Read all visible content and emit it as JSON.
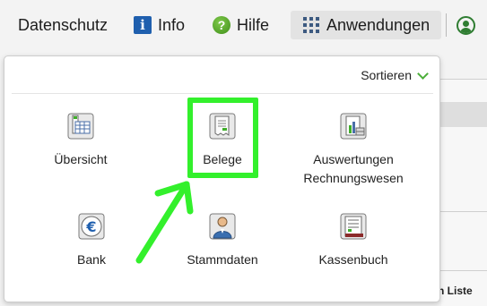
{
  "topbar": {
    "datenschutz": "Datenschutz",
    "info": "Info",
    "hilfe": "Hilfe",
    "anwendungen": "Anwendungen"
  },
  "menu": {
    "sort_label": "Sortieren",
    "items": [
      {
        "label": "Übersicht",
        "icon": "overview-icon"
      },
      {
        "label": "Belege",
        "icon": "receipts-icon"
      },
      {
        "label": "Auswertungen Rechnungswesen",
        "icon": "reports-icon"
      },
      {
        "label": "Bank",
        "icon": "bank-icon"
      },
      {
        "label": "Stammdaten",
        "icon": "master-data-icon"
      },
      {
        "label": "Kassenbuch",
        "icon": "cash-book-icon"
      }
    ]
  },
  "background": {
    "liste_text": "n Liste"
  },
  "colors": {
    "highlight": "#33f02c",
    "accent_green": "#4caf3a",
    "info_blue": "#1f5fae"
  }
}
